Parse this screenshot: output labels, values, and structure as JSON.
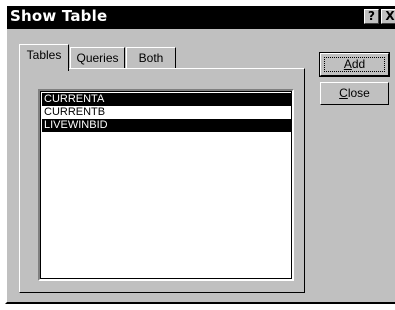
{
  "window": {
    "title": "Show Table",
    "help_glyph": "?",
    "close_glyph": "X"
  },
  "tabs": [
    {
      "label": "Tables",
      "active": true
    },
    {
      "label": "Queries",
      "active": false
    },
    {
      "label": "Both",
      "active": false
    }
  ],
  "list": {
    "items": [
      {
        "label": "CURRENTA",
        "selected": true
      },
      {
        "label": "CURRENTB",
        "selected": false
      },
      {
        "label": "LIVEWINBID",
        "selected": true
      }
    ]
  },
  "buttons": {
    "add": {
      "mnemonic": "A",
      "rest": "dd"
    },
    "close": {
      "mnemonic": "C",
      "rest": "lose"
    }
  },
  "colors": {
    "face": "#c0c0c0",
    "titlebar": "#000000",
    "selection": "#000000"
  }
}
